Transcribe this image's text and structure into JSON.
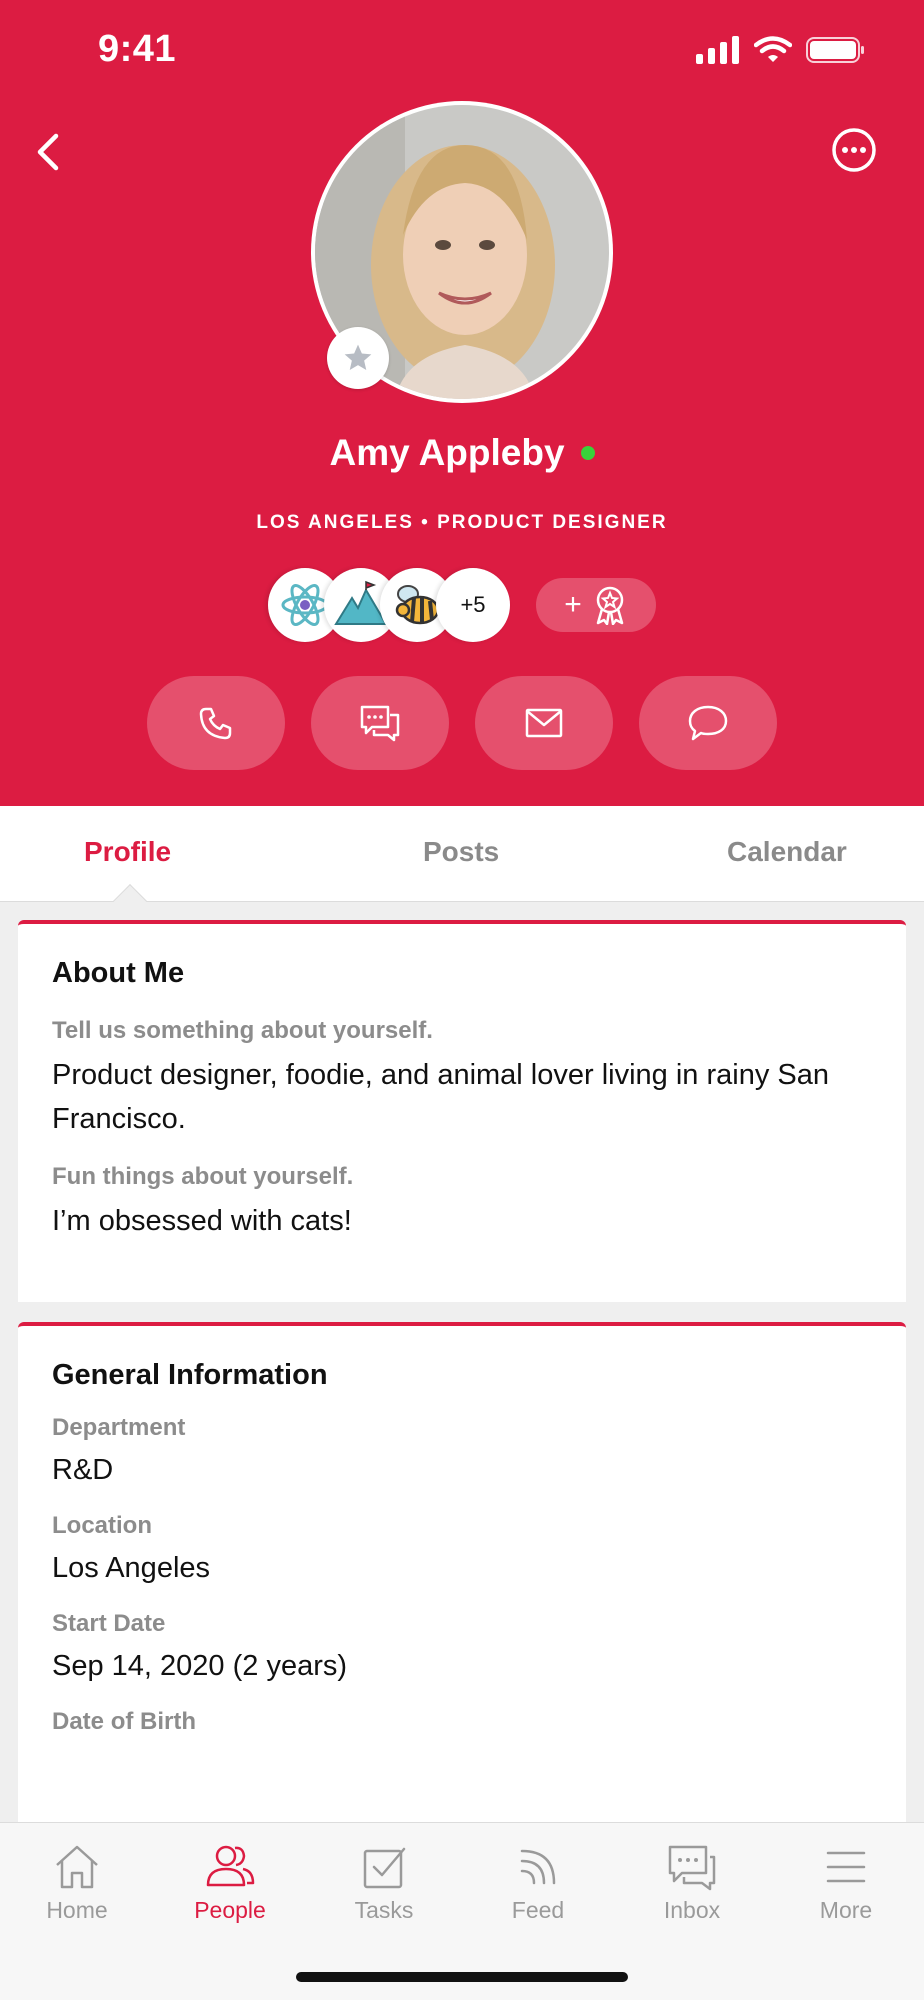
{
  "status_bar": {
    "time": "9:41"
  },
  "profile": {
    "name": "Amy Appleby",
    "subtitle": "LOS ANGELES • PRODUCT DESIGNER",
    "online": true,
    "badges": [
      "atom-icon",
      "mountain-icon",
      "bee-icon"
    ],
    "badges_more": "+5",
    "award_button_label": "+"
  },
  "actions": [
    "phone-icon",
    "sms-icon",
    "mail-icon",
    "chat-icon"
  ],
  "tabs": [
    {
      "label": "Profile",
      "active": true
    },
    {
      "label": "Posts",
      "active": false
    },
    {
      "label": "Calendar",
      "active": false
    }
  ],
  "about": {
    "title": "About Me",
    "q1_label": "Tell us something about yourself.",
    "q1_value": "Product designer, foodie, and animal lover living in rainy San Francisco.",
    "q2_label": "Fun things about yourself.",
    "q2_value": "I’m obsessed with cats!"
  },
  "general": {
    "title": "General Information",
    "department_label": "Department",
    "department_value": "R&D",
    "location_label": "Location",
    "location_value": "Los Angeles",
    "start_label": "Start Date",
    "start_value": "Sep 14, 2020 (2 years)",
    "dob_label": "Date of Birth"
  },
  "bottom_nav": [
    {
      "label": "Home",
      "icon": "home-icon",
      "active": false
    },
    {
      "label": "People",
      "icon": "people-icon",
      "active": true
    },
    {
      "label": "Tasks",
      "icon": "tasks-icon",
      "active": false
    },
    {
      "label": "Feed",
      "icon": "feed-icon",
      "active": false
    },
    {
      "label": "Inbox",
      "icon": "inbox-icon",
      "active": false
    },
    {
      "label": "More",
      "icon": "menu-icon",
      "active": false
    }
  ],
  "colors": {
    "accent": "#dc1c42",
    "accent_light": "#e5506d",
    "online": "#3ad23a"
  }
}
